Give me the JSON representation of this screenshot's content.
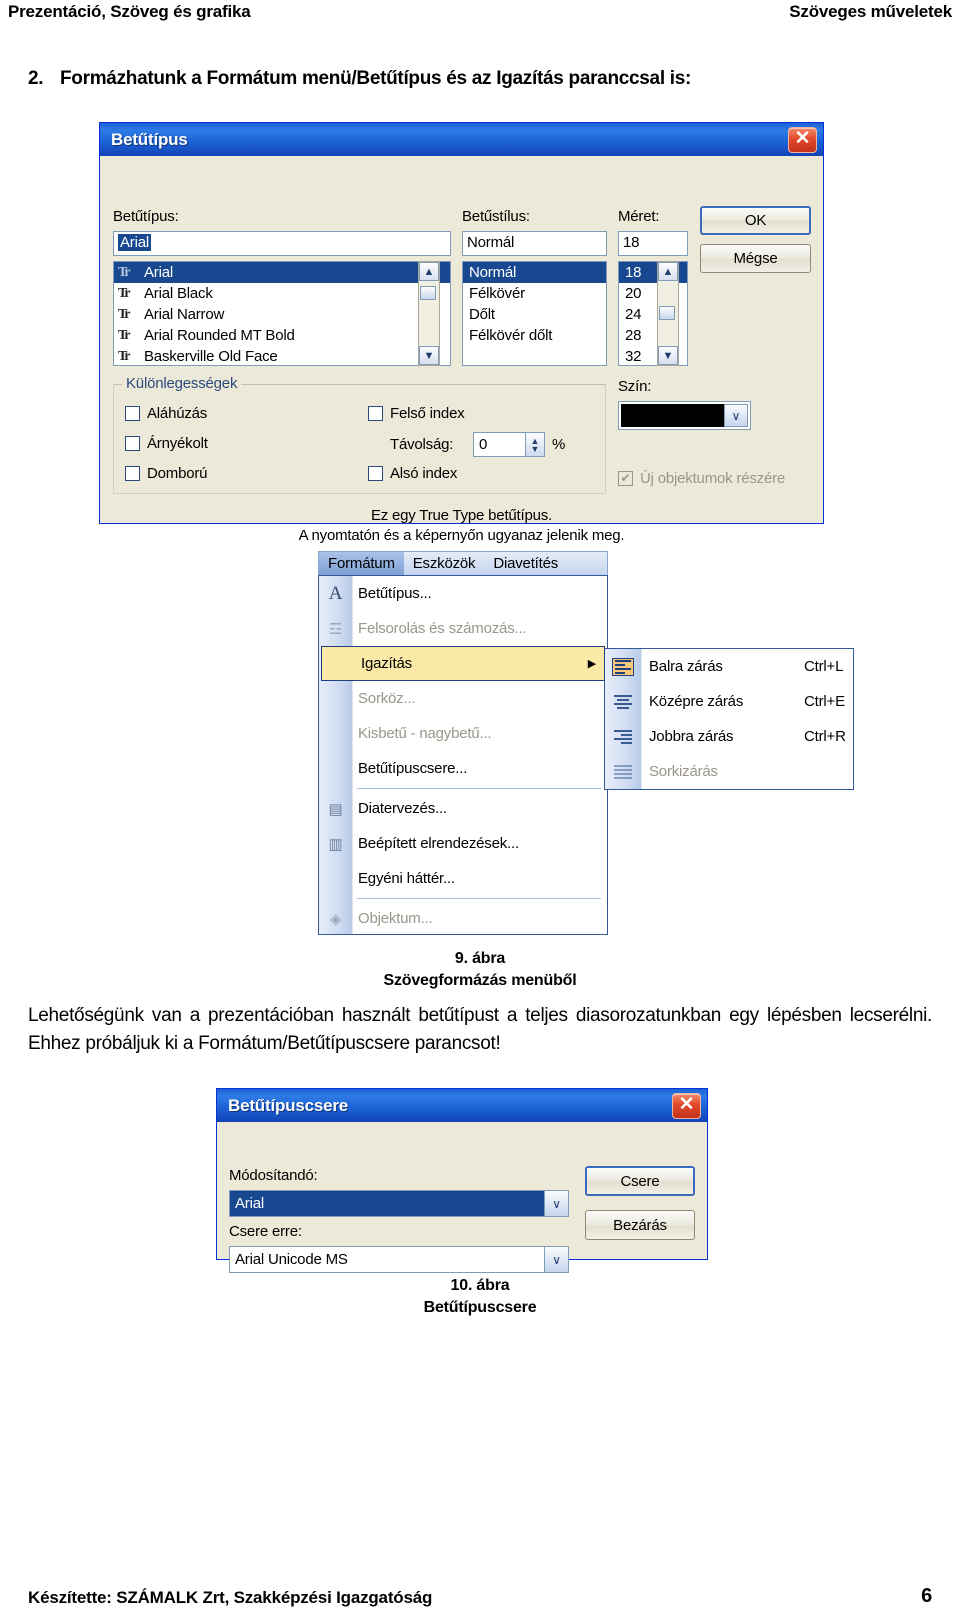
{
  "header": {
    "left": "Prezentáció, Szöveg és grafika",
    "right": "Szöveges műveletek"
  },
  "intro": {
    "number": "2.",
    "text": "Formázhatunk a Formátum menü/Betűtípus és az Igazítás paranccsal is:"
  },
  "font_dialog": {
    "title": "Betűtípus",
    "close_label": "✕",
    "font_label": "Betűtípus:",
    "font_value": "Arial",
    "font_list": [
      "Arial",
      "Arial Black",
      "Arial Narrow",
      "Arial Rounded MT Bold",
      "Baskerville Old Face"
    ],
    "style_label": "Betűstílus:",
    "style_value": "Normál",
    "style_list": [
      "Normál",
      "Félkövér",
      "Dőlt",
      "Félkövér dőlt"
    ],
    "size_label": "Méret:",
    "size_value": "18",
    "size_list": [
      "18",
      "20",
      "24",
      "28",
      "32"
    ],
    "ok_label": "OK",
    "cancel_label": "Mégse",
    "effects_caption": "Különlegességek",
    "effects": [
      "Aláhúzás",
      "Árnyékolt",
      "Domború",
      "Felső index",
      "Alsó index"
    ],
    "offset_label": "Távolság:",
    "offset_value": "0",
    "offset_unit": "%",
    "color_label": "Szín:",
    "color_value": "#000000",
    "new_objects_label": "Új objektumok részére",
    "info_line1": "Ez egy True Type betűtípus.",
    "info_line2": "A nyomtatón és a képernyőn ugyanaz jelenik meg.",
    "tt_icon": "Tr"
  },
  "menu": {
    "menubar": [
      "Formátum",
      "Eszközök",
      "Diavetítés"
    ],
    "items": [
      {
        "label": "Betűtípus...",
        "icon": "A",
        "state": "normal"
      },
      {
        "label": "Felsorolás és számozás...",
        "icon": "list",
        "state": "disabled"
      },
      {
        "label": "Igazítás",
        "icon": "",
        "state": "highlighted",
        "arrow": "▶"
      },
      {
        "label": "Sorköz...",
        "icon": "",
        "state": "disabled"
      },
      {
        "label": "Kisbetű - nagybetű...",
        "icon": "",
        "state": "disabled"
      },
      {
        "label": "Betűtípuscsere...",
        "icon": "",
        "state": "normal"
      },
      {
        "label": "Diatervezés...",
        "icon": "design",
        "state": "normal"
      },
      {
        "label": "Beépített elrendezések...",
        "icon": "layout",
        "state": "normal"
      },
      {
        "label": "Egyéni háttér...",
        "icon": "",
        "state": "normal"
      },
      {
        "label": "Objektum...",
        "icon": "object",
        "state": "disabled"
      }
    ],
    "submenu": [
      {
        "label": "Balra zárás",
        "shortcut": "Ctrl+L",
        "state": "current",
        "align": "left"
      },
      {
        "label": "Középre zárás",
        "shortcut": "Ctrl+E",
        "state": "normal",
        "align": "center"
      },
      {
        "label": "Jobbra zárás",
        "shortcut": "Ctrl+R",
        "state": "normal",
        "align": "right"
      },
      {
        "label": "Sorkizárás",
        "shortcut": "",
        "state": "disabled",
        "align": "justify"
      }
    ]
  },
  "figure9": {
    "number": "9. ábra",
    "caption": "Szövegformázás menüből"
  },
  "body_text": "Lehetőségünk van a prezentációban használt betűtípust a teljes diasorozatunkban egy lépésben lecserélni. Ehhez próbáljuk ki a Formátum/Betűtípuscsere parancsot!",
  "replace_dialog": {
    "title": "Betűtípuscsere",
    "close_label": "✕",
    "source_label": "Módosítandó:",
    "source_value": "Arial",
    "target_label": "Csere erre:",
    "target_value": "Arial Unicode MS",
    "replace_label": "Csere",
    "close_button_label": "Bezárás",
    "dropdown_glyph": "∨"
  },
  "figure10": {
    "number": "10. ábra",
    "caption": "Betűtípuscsere"
  },
  "footer": {
    "left": "Készítette: SZÁMALK Zrt, Szakképzési Igazgatóság",
    "page": "6"
  }
}
